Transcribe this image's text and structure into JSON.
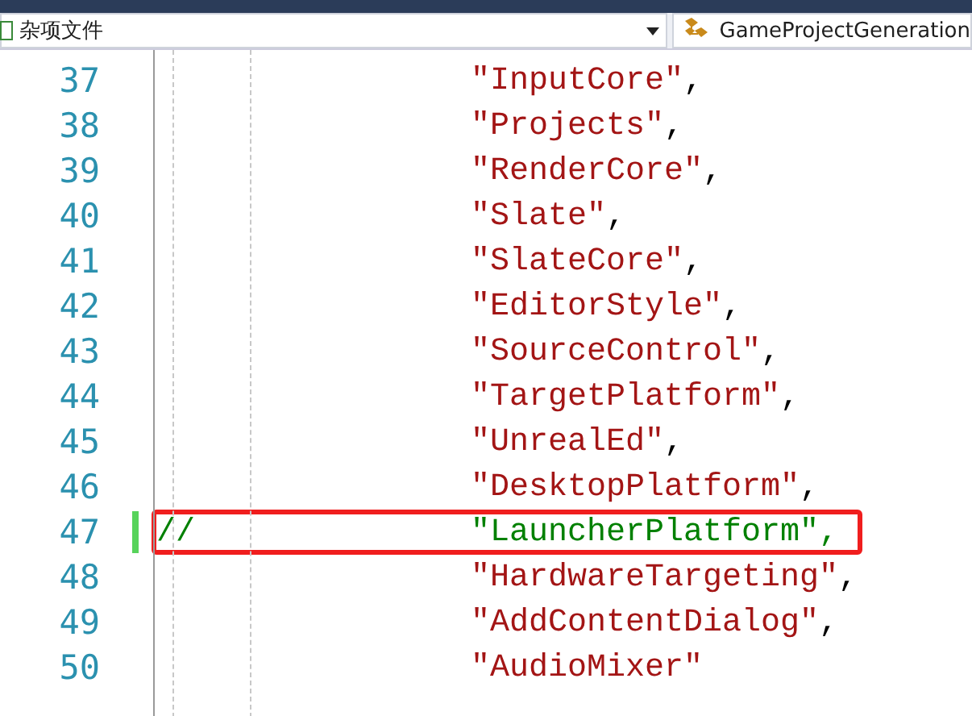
{
  "navigation_bar": {
    "file_scope": "杂项文件",
    "member": "GameProjectGeneration"
  },
  "code_lines": [
    {
      "number": "37",
      "kind": "string",
      "string": "\"InputCore\"",
      "punct": ",",
      "changed": false,
      "highlighted": false
    },
    {
      "number": "38",
      "kind": "string",
      "string": "\"Projects\"",
      "punct": ",",
      "changed": false,
      "highlighted": false
    },
    {
      "number": "39",
      "kind": "string",
      "string": "\"RenderCore\"",
      "punct": ",",
      "changed": false,
      "highlighted": false
    },
    {
      "number": "40",
      "kind": "string",
      "string": "\"Slate\"",
      "punct": ",",
      "changed": false,
      "highlighted": false
    },
    {
      "number": "41",
      "kind": "string",
      "string": "\"SlateCore\"",
      "punct": ",",
      "changed": false,
      "highlighted": false
    },
    {
      "number": "42",
      "kind": "string",
      "string": "\"EditorStyle\"",
      "punct": ",",
      "changed": false,
      "highlighted": false
    },
    {
      "number": "43",
      "kind": "string",
      "string": "\"SourceControl\"",
      "punct": ",",
      "changed": false,
      "highlighted": false
    },
    {
      "number": "44",
      "kind": "string",
      "string": "\"TargetPlatform\"",
      "punct": ",",
      "changed": false,
      "highlighted": false
    },
    {
      "number": "45",
      "kind": "string",
      "string": "\"UnrealEd\"",
      "punct": ",",
      "changed": false,
      "highlighted": false
    },
    {
      "number": "46",
      "kind": "string",
      "string": "\"DesktopPlatform\"",
      "punct": ",",
      "changed": false,
      "highlighted": false
    },
    {
      "number": "47",
      "kind": "comment",
      "comment_marker": "//",
      "string": "\"LauncherPlatform\"",
      "punct": ",",
      "changed": true,
      "highlighted": true
    },
    {
      "number": "48",
      "kind": "string",
      "string": "\"HardwareTargeting\"",
      "punct": ",",
      "changed": false,
      "highlighted": false
    },
    {
      "number": "49",
      "kind": "string",
      "string": "\"AddContentDialog\"",
      "punct": ",",
      "changed": false,
      "highlighted": false
    },
    {
      "number": "50",
      "kind": "string",
      "string": "\"AudioMixer\"",
      "changed": false,
      "highlighted": false
    }
  ]
}
